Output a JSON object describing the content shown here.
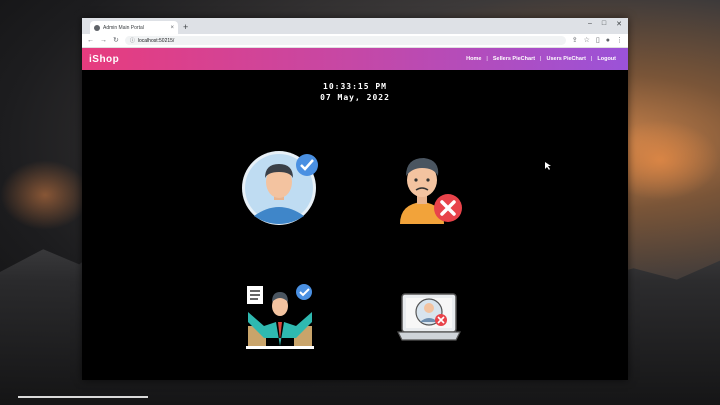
{
  "browser": {
    "tab_title": "Admin Main Portal",
    "url": "localhost:50215/",
    "new_tab_symbol": "+",
    "close_symbol": "×",
    "window_controls": [
      "–",
      "□",
      "✕"
    ]
  },
  "navbar": {
    "brand": "iShop",
    "links": [
      "Home",
      "Sellers PieChart",
      "Users PieChart",
      "Logout"
    ],
    "separator": "|",
    "gradient": [
      "#e73c7e",
      "#9b52d8"
    ]
  },
  "clock": {
    "time": "10:33:15 PM",
    "date": "07 May, 2022"
  },
  "tiles": [
    {
      "icon": "verified-user-icon"
    },
    {
      "icon": "blocked-user-icon"
    },
    {
      "icon": "verified-seller-icon"
    },
    {
      "icon": "blocked-seller-icon"
    }
  ]
}
